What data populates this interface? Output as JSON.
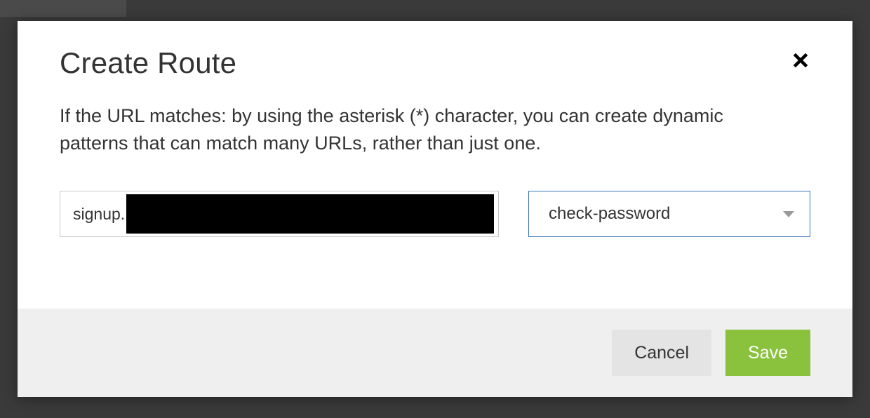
{
  "modal": {
    "title": "Create Route",
    "description": "If the URL matches: by using the asterisk (*) character, you can create dynamic patterns that can match many URLs, rather than just one.",
    "url_input": {
      "prefix": "signup.",
      "redacted": true
    },
    "worker_select": {
      "selected": "check-password"
    },
    "buttons": {
      "cancel": "Cancel",
      "save": "Save"
    }
  },
  "colors": {
    "accent_green": "#8ac23e",
    "select_border": "#3b73b9"
  }
}
